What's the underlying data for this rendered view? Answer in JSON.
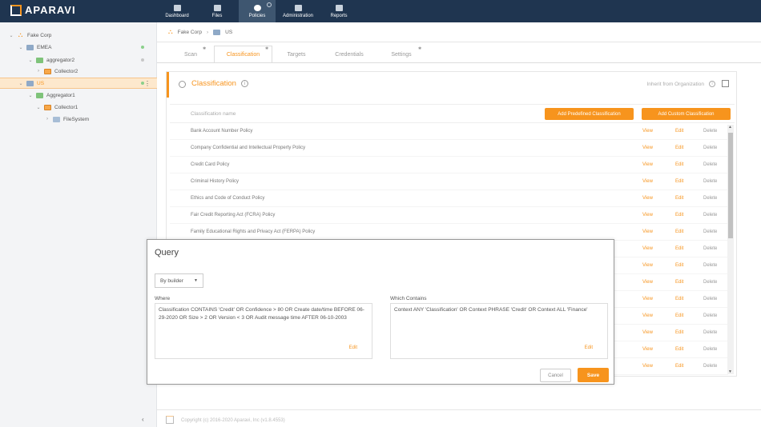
{
  "app": {
    "logo_text": "APARAVI"
  },
  "nav": [
    {
      "label": "Dashboard",
      "icon": "dashboard-icon"
    },
    {
      "label": "Files",
      "icon": "folder-icon"
    },
    {
      "label": "Policies",
      "icon": "gear-icon"
    },
    {
      "label": "Administration",
      "icon": "users-icon"
    },
    {
      "label": "Reports",
      "icon": "report-icon"
    }
  ],
  "tree": [
    {
      "label": "Fake Corp",
      "icon": "org-icon"
    },
    {
      "label": "EMEA",
      "icon": "folder-icon"
    },
    {
      "label": "aggregator2",
      "icon": "aggregator-icon"
    },
    {
      "label": "Collector2",
      "icon": "collector-icon"
    },
    {
      "label": "US",
      "icon": "folder-icon"
    },
    {
      "label": "Aggregator1",
      "icon": "aggregator-icon"
    },
    {
      "label": "Collector1",
      "icon": "collector-icon"
    },
    {
      "label": "FileSystem",
      "icon": "filesystem-icon"
    }
  ],
  "breadcrumb": {
    "org": "Fake Corp",
    "folder": "US"
  },
  "tabs": [
    "Scan",
    "Classification",
    "Targets",
    "Credentials",
    "Settings"
  ],
  "panel": {
    "title": "Classification",
    "inherit_label": "Inherit from Organization",
    "column_name": "Classification name",
    "add_predefined": "Add Predefined Classification",
    "add_custom": "Add Custom Classification",
    "view_label": "View",
    "edit_label": "Edit",
    "delete_label": "Delete",
    "rows": [
      "Bank Account Number Policy",
      "Company Confidential and Intellectual Property Policy",
      "Credit Card Policy",
      "Criminal History Policy",
      "Ethics and Code of Conduct Policy",
      "Fair Credit Reporting Act (FCRA) Policy",
      "Family Educational Rights and Privacy Act (FERPA) Policy"
    ],
    "extra_action_rows": 8
  },
  "query": {
    "title": "Query",
    "mode": "By builder",
    "where_label": "Where",
    "where_text": "Classification CONTAINS 'Credit' OR Confidence > 80 OR Create date/time BEFORE 06-29-2020 OR Size > 2 OR Version < 3 OR Audit message time AFTER 06-10-2003",
    "where_edit": "Edit",
    "contains_label": "Which Contains",
    "contains_text": "Context ANY 'Classification' OR Context PHRASE 'Credit' OR Context ALL 'Finance'",
    "contains_edit": "Edit",
    "cancel": "Cancel",
    "save": "Save"
  },
  "footer": {
    "copyright": "Copyright (c) 2016-2020 Aparavi, Inc (v1.8.4553)"
  },
  "colors": {
    "accent": "#f7941d",
    "topbar": "#1f3550"
  }
}
